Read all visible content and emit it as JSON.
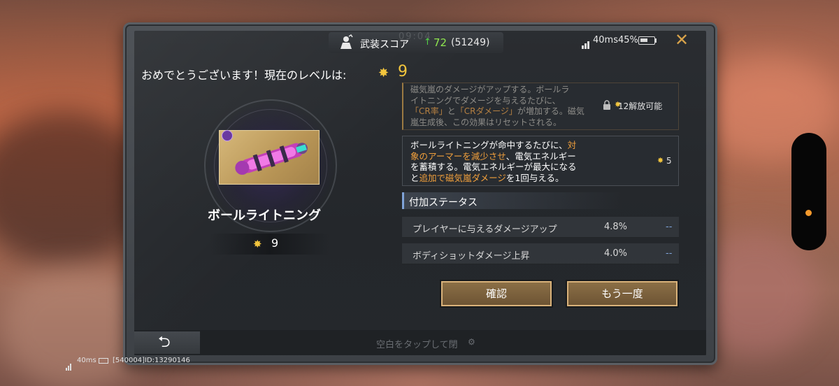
{
  "status_bar": {
    "score_label": "武装スコア",
    "score_arrow": "↑",
    "score_value": "72",
    "score_total": "(51249)",
    "clock": "09:04",
    "ping": "40ms45%"
  },
  "header": {
    "congrats": "おめでとうございます！現在のレベルは:",
    "level": "9"
  },
  "weapon": {
    "name": "ボールライトニング",
    "level": "9"
  },
  "skills": [
    {
      "lines": [
        {
          "text": "磁気嵐のダメージがアップする。ボールラ"
        },
        {
          "text": "イトニングでダメージを与えるたびに、"
        },
        {
          "seg1": "「CR率」",
          "seg2": "と",
          "seg3": "「CRダメージ」",
          "seg4": "が増加する。磁気"
        },
        {
          "text": "嵐生成後、この効果はリセットされる。"
        }
      ],
      "requirement": "12解放可能",
      "locked": true
    },
    {
      "line1_a": "ボールライトニングが命中するたびに、",
      "line1_b": "対",
      "line2_a": "象のアーマーを減少させ",
      "line2_b": "、電気エネルギー",
      "line3": "を蓄積する。電気エネルギーが最大になる",
      "line4_a": "と",
      "line4_b": "追加で磁気嵐ダメージ",
      "line4_c": "を1回与える。",
      "requirement": "5"
    }
  ],
  "additional": {
    "title": "付加ステータス",
    "rows": [
      {
        "label": "プレイヤーに与えるダメージアップ",
        "value": "4.8%",
        "next": "--"
      },
      {
        "label": "ボディショットダメージ上昇",
        "value": "4.0%",
        "next": "--"
      }
    ]
  },
  "buttons": {
    "confirm": "確認",
    "again": "もう一度"
  },
  "bottom": {
    "tap_close": "空白をタップして閉"
  },
  "footer": {
    "ping": "40ms",
    "id": "[540004]ID:13290146"
  },
  "colors": {
    "accent_gold": "#f2c53d",
    "highlight_orange": "#f2a03c",
    "score_green": "#8fe64f",
    "button_border": "#d9b27a"
  }
}
